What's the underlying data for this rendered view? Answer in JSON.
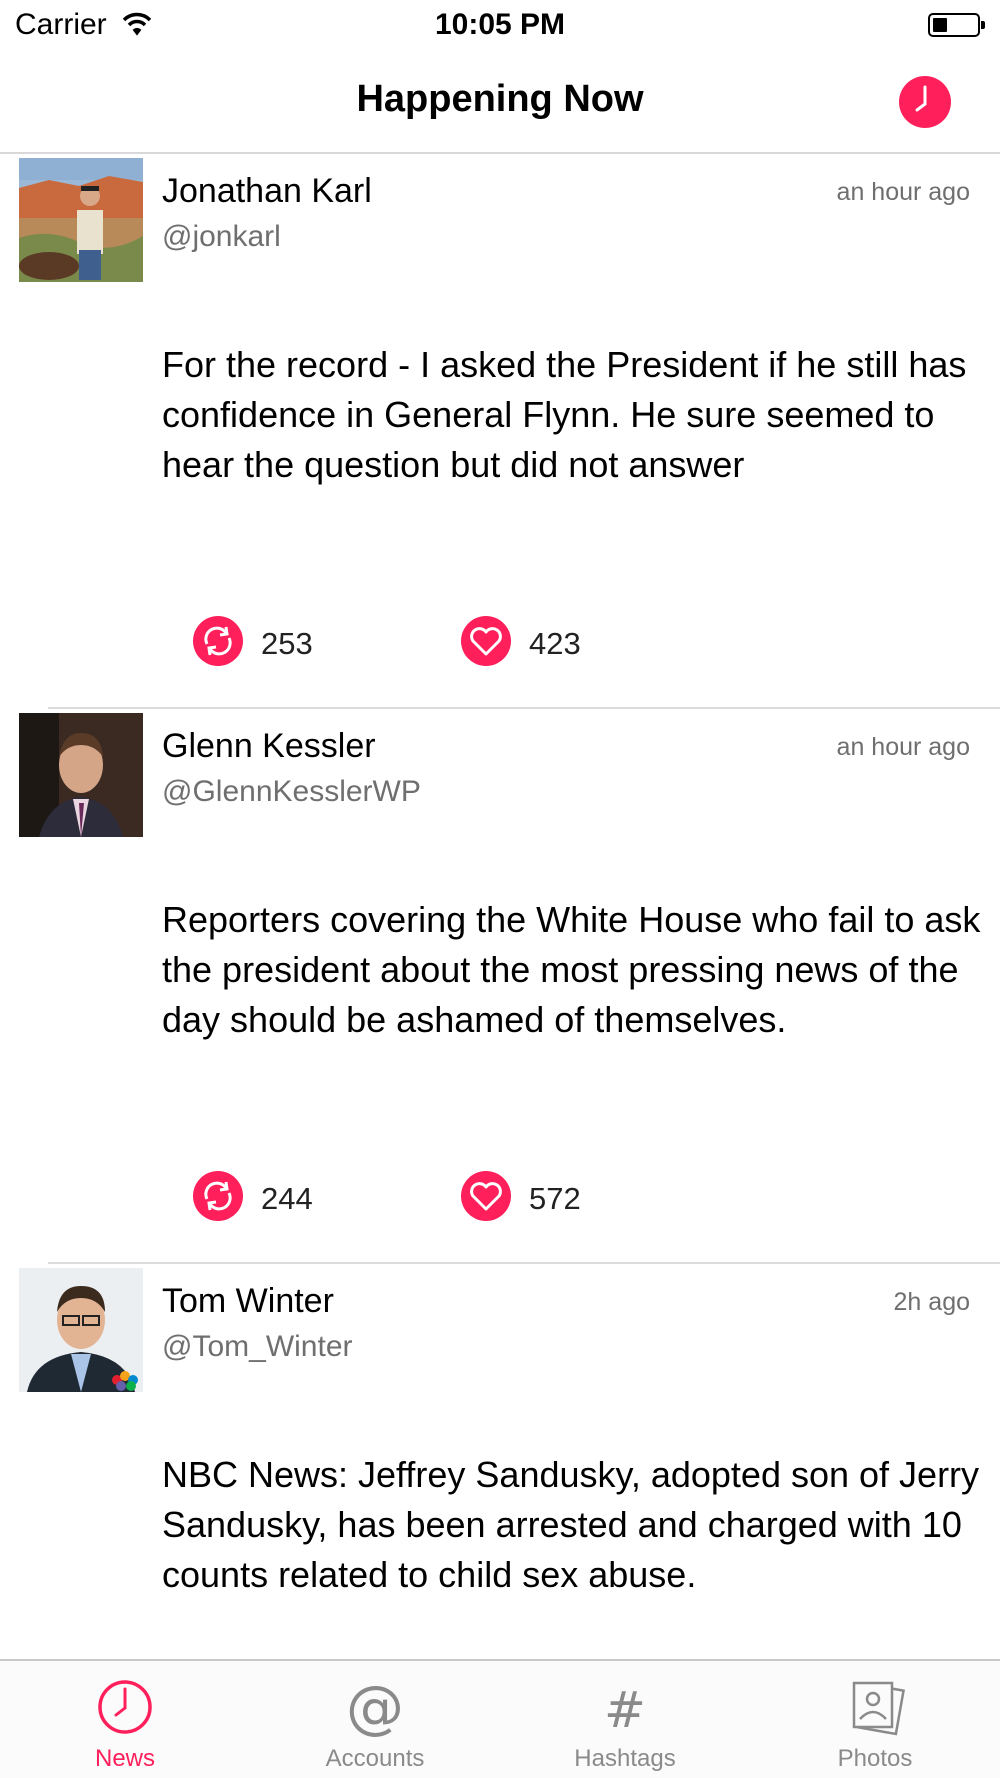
{
  "status_bar": {
    "carrier": "Carrier",
    "time": "10:05 PM",
    "battery_level": 0.25
  },
  "nav": {
    "title": "Happening Now",
    "clock_icon": "clock-icon"
  },
  "colors": {
    "accent": "#ff1f5b",
    "secondary_text": "#6f6f6f",
    "tab_inactive": "#8a8a8a",
    "divider": "#dcdcdc"
  },
  "tweets": [
    {
      "name": "Jonathan Karl",
      "handle": "@jonkarl",
      "time": "an hour ago",
      "text": "For the record - I asked the President if he still has confidence in General Flynn. He sure seemed to hear the question but did not answer",
      "retweets": "253",
      "likes": "423"
    },
    {
      "name": "Glenn Kessler",
      "handle": "@GlennKesslerWP",
      "time": "an hour ago",
      "text": "Reporters covering the White House who fail to ask the president about the most pressing news of the day should be ashamed of themselves.",
      "retweets": "244",
      "likes": "572"
    },
    {
      "name": "Tom Winter",
      "handle": "@Tom_Winter",
      "time": "2h ago",
      "text": "NBC News: Jeffrey Sandusky, adopted son of Jerry Sandusky, has been arrested and charged with 10 counts related to child sex abuse.",
      "retweets": "",
      "likes": ""
    }
  ],
  "tabs": [
    {
      "label": "News",
      "icon": "clock-icon",
      "active": true
    },
    {
      "label": "Accounts",
      "icon": "at-sign-icon",
      "active": false
    },
    {
      "label": "Hashtags",
      "icon": "hashtag-icon",
      "active": false
    },
    {
      "label": "Photos",
      "icon": "photos-icon",
      "active": false
    }
  ]
}
